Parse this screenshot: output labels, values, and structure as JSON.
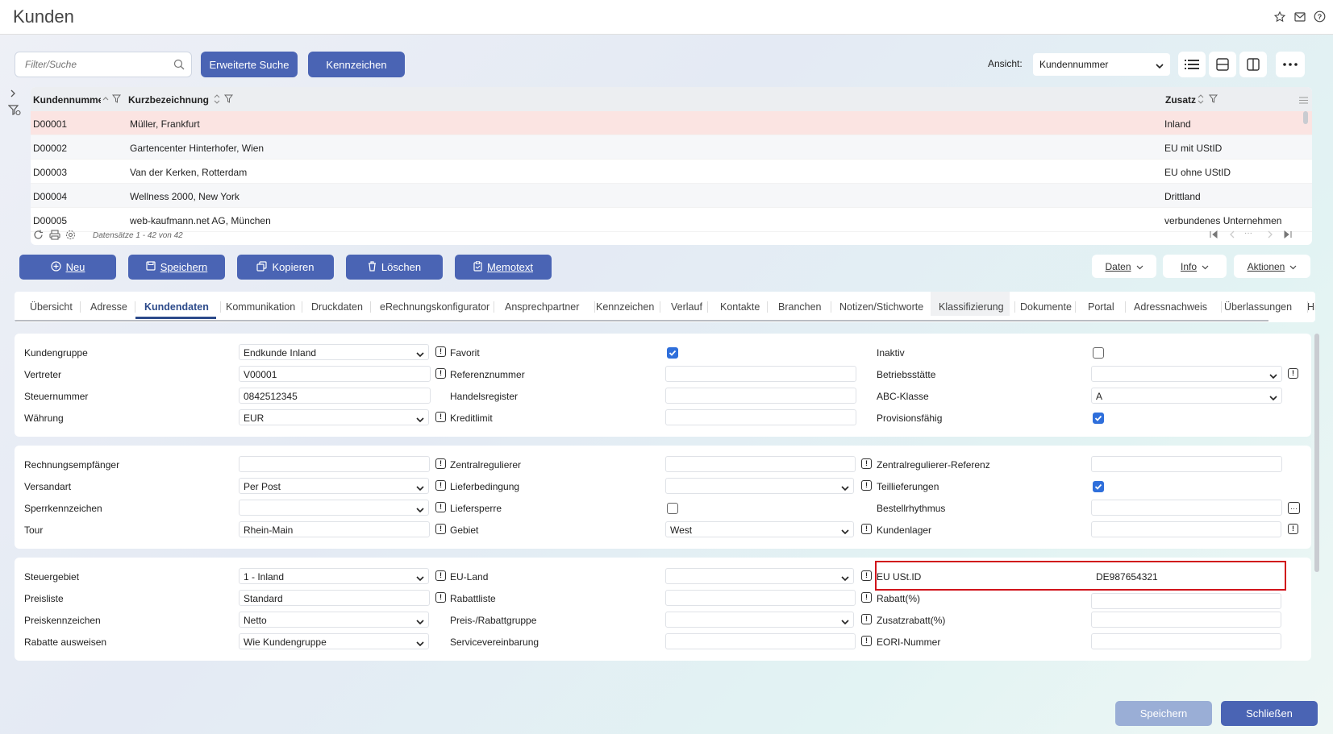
{
  "window": {
    "title": "Kunden"
  },
  "toolbar": {
    "filter_placeholder": "Filter/Suche",
    "advanced_search": "Erweiterte Suche",
    "tags": "Kennzeichen",
    "view_label": "Ansicht:",
    "view_value": "Kundennummer"
  },
  "grid": {
    "columns": [
      "Kundennummer",
      "Kurzbezeichnung",
      "Zusatz"
    ],
    "rows": [
      {
        "id": "D00001",
        "name": "Müller, Frankfurt",
        "extra": "Inland"
      },
      {
        "id": "D00002",
        "name": "Gartencenter Hinterhofer, Wien",
        "extra": "EU mit UStID"
      },
      {
        "id": "D00003",
        "name": "Van der Kerken, Rotterdam",
        "extra": "EU ohne UStID"
      },
      {
        "id": "D00004",
        "name": "Wellness 2000, New York",
        "extra": "Drittland"
      },
      {
        "id": "D00005",
        "name": "web-kaufmann.net AG, München",
        "extra": "verbundenes Unternehmen"
      }
    ],
    "records": "Datensätze 1 - 42 von 42"
  },
  "actions": {
    "new": "Neu",
    "save": "Speichern",
    "copy": "Kopieren",
    "delete": "Löschen",
    "memo": "Memotext",
    "data": "Daten",
    "info": "Info",
    "actions": "Aktionen"
  },
  "tabs": [
    "Übersicht",
    "Adresse",
    "Kundendaten",
    "Kommunikation",
    "Druckdaten",
    "eRechnungskonfigurator",
    "Ansprechpartner",
    "Kennzeichen",
    "Verlauf",
    "Kontakte",
    "Branchen",
    "Notizen/Stichworte",
    "Klassifizierung",
    "Dokumente",
    "Portal",
    "Adressnachweis",
    "Überlassungen",
    "His"
  ],
  "p1": {
    "kundengruppe_l": "Kundengruppe",
    "kundengruppe_v": "Endkunde Inland",
    "vertreter_l": "Vertreter",
    "vertreter_v": "V00001",
    "steuernummer_l": "Steuernummer",
    "steuernummer_v": "0842512345",
    "waehrung_l": "Währung",
    "waehrung_v": "EUR",
    "favorit_l": "Favorit",
    "referenz_l": "Referenznummer",
    "handelsregister_l": "Handelsregister",
    "kreditlimit_l": "Kreditlimit",
    "inaktiv_l": "Inaktiv",
    "betriebsstaette_l": "Betriebsstätte",
    "abc_l": "ABC-Klasse",
    "abc_v": "A",
    "provision_l": "Provisionsfähig"
  },
  "p2": {
    "rechnung_l": "Rechnungsempfänger",
    "versandart_l": "Versandart",
    "versandart_v": "Per Post",
    "sperr_l": "Sperrkennzeichen",
    "tour_l": "Tour",
    "tour_v": "Rhein-Main",
    "zentral_l": "Zentralregulierer",
    "liefer_l": "Lieferbedingung",
    "sperre_l": "Liefersperre",
    "gebiet_l": "Gebiet",
    "gebiet_v": "West",
    "zentralref_l": "Zentralregulierer-Referenz",
    "teil_l": "Teillieferungen",
    "bestell_l": "Bestellrhythmus",
    "lager_l": "Kundenlager"
  },
  "p3": {
    "steuergebiet_l": "Steuergebiet",
    "steuergebiet_v": "1 - Inland",
    "preisliste_l": "Preisliste",
    "preisliste_v": "Standard",
    "preiskz_l": "Preiskennzeichen",
    "preiskz_v": "Netto",
    "rabatte_l": "Rabatte ausweisen",
    "rabatte_v": "Wie Kundengruppe",
    "euland_l": "EU-Land",
    "rabattliste_l": "Rabattliste",
    "preisrabatt_l": "Preis-/Rabattgruppe",
    "service_l": "Servicevereinbarung",
    "ustid_l": "EU USt.ID",
    "ustid_v": "DE987654321",
    "rabatt_l": "Rabatt(%)",
    "zusatz_l": "Zusatzrabatt(%)",
    "eori_l": "EORI-Nummer"
  },
  "footer": {
    "save": "Speichern",
    "close": "Schließen"
  }
}
